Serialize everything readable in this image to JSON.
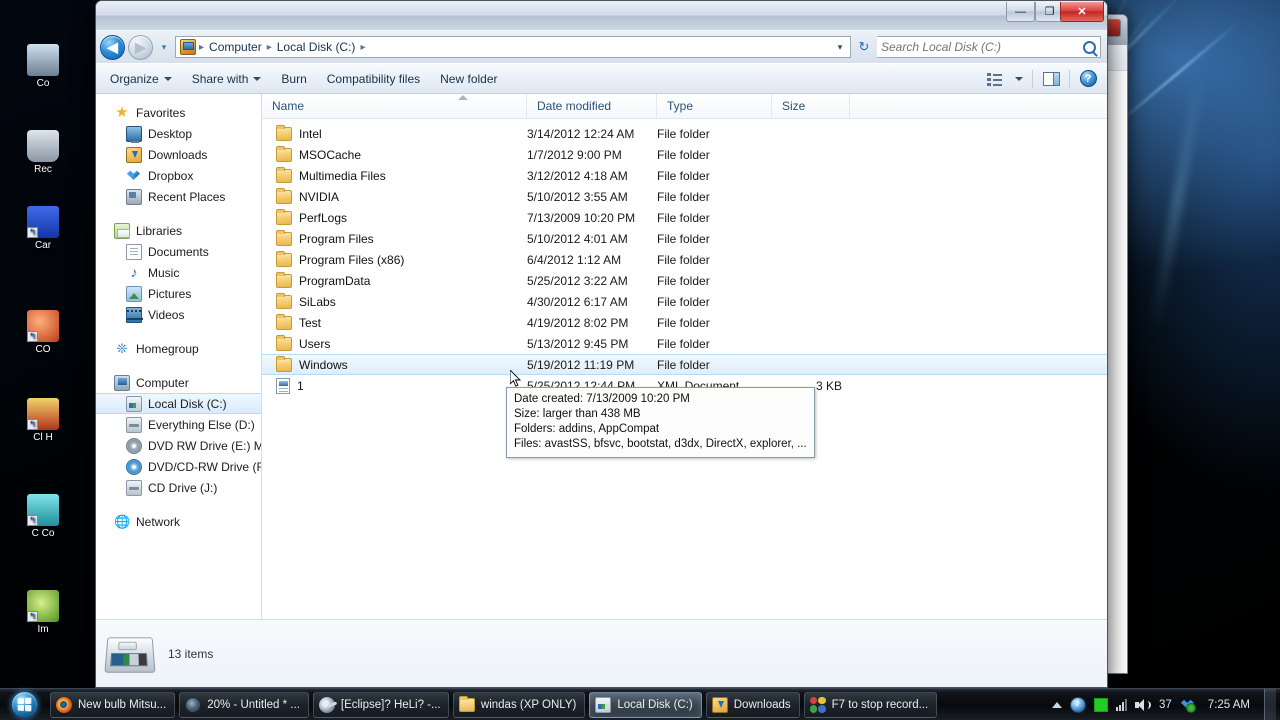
{
  "window": {
    "title_controls": {
      "minimize": "—",
      "maximize": "❐",
      "close": "✕"
    }
  },
  "address": {
    "back_label": "◀",
    "forward_label": "▶",
    "recent_label": "▾",
    "crumbs": [
      "Computer",
      "Local Disk (C:)"
    ],
    "separator": "▸",
    "dropdown": "▾",
    "refresh": "↻"
  },
  "search": {
    "placeholder": "Search Local Disk (C:)",
    "value": ""
  },
  "commandbar": {
    "items": [
      {
        "label": "Organize",
        "has_caret": true
      },
      {
        "label": "Share with",
        "has_caret": true
      },
      {
        "label": "Burn",
        "has_caret": false
      },
      {
        "label": "Compatibility files",
        "has_caret": false
      },
      {
        "label": "New folder",
        "has_caret": false
      }
    ],
    "help_label": "?"
  },
  "navpane": {
    "groups": [
      {
        "header": {
          "label": "Favorites",
          "icon": "star-icon"
        },
        "items": [
          {
            "label": "Desktop",
            "icon": "desktop-icon"
          },
          {
            "label": "Downloads",
            "icon": "downloads-icon"
          },
          {
            "label": "Dropbox",
            "icon": "dropbox-icon"
          },
          {
            "label": "Recent Places",
            "icon": "recent-places-icon"
          }
        ]
      },
      {
        "header": {
          "label": "Libraries",
          "icon": "libraries-icon"
        },
        "items": [
          {
            "label": "Documents",
            "icon": "documents-icon"
          },
          {
            "label": "Music",
            "icon": "music-icon"
          },
          {
            "label": "Pictures",
            "icon": "pictures-icon"
          },
          {
            "label": "Videos",
            "icon": "videos-icon"
          }
        ]
      },
      {
        "header": {
          "label": "Homegroup",
          "icon": "homegroup-icon"
        },
        "items": []
      },
      {
        "header": {
          "label": "Computer",
          "icon": "computer-icon"
        },
        "items": [
          {
            "label": "Local Disk (C:)",
            "icon": "hard-disk-icon",
            "selected": true
          },
          {
            "label": "Everything Else (D:)",
            "icon": "drive-icon"
          },
          {
            "label": "DVD RW Drive (E:) Ma",
            "icon": "dvd-rw-icon"
          },
          {
            "label": "DVD/CD-RW Drive (F:",
            "icon": "dvd-cd-rw-icon"
          },
          {
            "label": "CD Drive (J:)",
            "icon": "cd-drive-icon"
          }
        ]
      },
      {
        "header": {
          "label": "Network",
          "icon": "network-icon"
        },
        "items": []
      }
    ]
  },
  "filelist": {
    "columns": [
      "Name",
      "Date modified",
      "Type",
      "Size"
    ],
    "sort_column": "Name",
    "sort_direction": "ascending",
    "rows": [
      {
        "name": "Intel",
        "date": "3/14/2012 12:24 AM",
        "type": "File folder",
        "size": "",
        "icon": "folder-icon"
      },
      {
        "name": "MSOCache",
        "date": "1/7/2012 9:00 PM",
        "type": "File folder",
        "size": "",
        "icon": "folder-icon"
      },
      {
        "name": "Multimedia Files",
        "date": "3/12/2012 4:18 AM",
        "type": "File folder",
        "size": "",
        "icon": "folder-icon"
      },
      {
        "name": "NVIDIA",
        "date": "5/10/2012 3:55 AM",
        "type": "File folder",
        "size": "",
        "icon": "folder-icon"
      },
      {
        "name": "PerfLogs",
        "date": "7/13/2009 10:20 PM",
        "type": "File folder",
        "size": "",
        "icon": "folder-icon"
      },
      {
        "name": "Program Files",
        "date": "5/10/2012 4:01 AM",
        "type": "File folder",
        "size": "",
        "icon": "folder-icon"
      },
      {
        "name": "Program Files (x86)",
        "date": "6/4/2012 1:12 AM",
        "type": "File folder",
        "size": "",
        "icon": "folder-icon"
      },
      {
        "name": "ProgramData",
        "date": "5/25/2012 3:22 AM",
        "type": "File folder",
        "size": "",
        "icon": "folder-icon"
      },
      {
        "name": "SiLabs",
        "date": "4/30/2012 6:17 AM",
        "type": "File folder",
        "size": "",
        "icon": "folder-icon"
      },
      {
        "name": "Test",
        "date": "4/19/2012 8:02 PM",
        "type": "File folder",
        "size": "",
        "icon": "folder-icon"
      },
      {
        "name": "Users",
        "date": "5/13/2012 9:45 PM",
        "type": "File folder",
        "size": "",
        "icon": "folder-icon"
      },
      {
        "name": "Windows",
        "date": "5/19/2012 11:19 PM",
        "type": "File folder",
        "size": "",
        "icon": "folder-icon",
        "selected": true
      },
      {
        "name": "1",
        "date": "5/25/2012 12:44 PM",
        "type": "XML Document",
        "size": "3 KB",
        "icon": "xml-document-icon"
      }
    ]
  },
  "tooltip": {
    "lines": [
      "Date created: 7/13/2009 10:20 PM",
      "Size: larger than 438 MB",
      "Folders: addins, AppCompat",
      "Files: avastSS, bfsvc, bootstat, d3dx, DirectX, explorer, ..."
    ]
  },
  "statusbar": {
    "items_text": "13 items"
  },
  "taskbar": {
    "start_label": "Start",
    "buttons": [
      {
        "label": "New bulb Mitsu...",
        "icon": "firefox-icon",
        "active": false
      },
      {
        "label": "20% - Untitled * ...",
        "icon": "app-dark-icon",
        "active": false
      },
      {
        "label": "[Eclipse]? HeLi? -...",
        "icon": "eclipse-icon",
        "active": false
      },
      {
        "label": "windas (XP ONLY)",
        "icon": "folder-icon",
        "active": false
      },
      {
        "label": "Local Disk (C:)",
        "icon": "hard-disk-icon",
        "active": true
      },
      {
        "label": "Downloads",
        "icon": "downloads-icon",
        "active": false
      },
      {
        "label": "F7 to stop record...",
        "icon": "recorder-icon",
        "active": false
      }
    ],
    "tray": {
      "show_hidden": "▲",
      "icons": [
        "itunes-icon",
        "green-square-icon",
        "network-signal-icon",
        "volume-icon",
        "dropbox-icon"
      ],
      "battery_text": "37",
      "clock": "7:25 AM"
    }
  },
  "desktop": {
    "icons": [
      {
        "label": "Co",
        "color": "#6f7c8a"
      },
      {
        "label": "Rec",
        "color": "#9aa8b6"
      },
      {
        "label": "Car",
        "color": "#2a4fd0"
      },
      {
        "label": "CO",
        "color": "#d04a2a"
      },
      {
        "label": "Cl H",
        "color": "#c8b23a"
      },
      {
        "label": "C Co",
        "color": "#3ac8d0"
      },
      {
        "label": "Im",
        "color": "#8fc84a"
      }
    ]
  }
}
